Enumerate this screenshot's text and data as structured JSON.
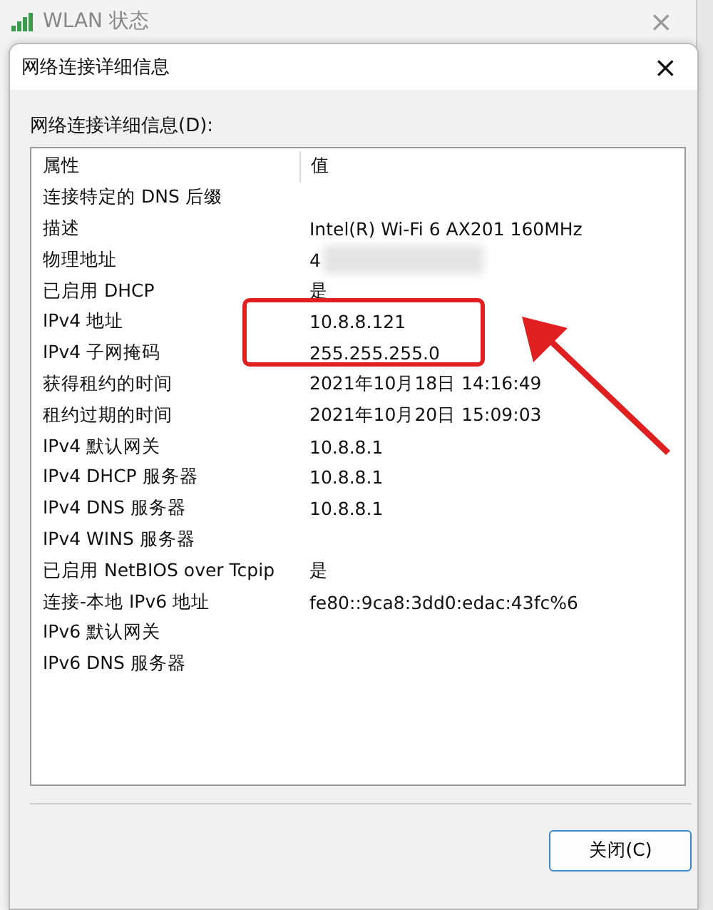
{
  "background_window": {
    "title": "WLAN 状态",
    "close": "×"
  },
  "dialog": {
    "title": "网络连接详细信息",
    "close": "×",
    "list_label": "网络连接详细信息(D):"
  },
  "table": {
    "columns": [
      "属性",
      "值"
    ],
    "rows": [
      {
        "property": "连接特定的 DNS 后缀",
        "value": ""
      },
      {
        "property": "描述",
        "value": "Intel(R) Wi-Fi 6 AX201 160MHz"
      },
      {
        "property": "物理地址",
        "value": "4",
        "redacted": true
      },
      {
        "property": "已启用 DHCP",
        "value": "是"
      },
      {
        "property": "IPv4 地址",
        "value": "10.8.8.121"
      },
      {
        "property": "IPv4 子网掩码",
        "value": "255.255.255.0"
      },
      {
        "property": "获得租约的时间",
        "value": "2021年10月18日 14:16:49"
      },
      {
        "property": "租约过期的时间",
        "value": "2021年10月20日 15:09:03"
      },
      {
        "property": "IPv4 默认网关",
        "value": "10.8.8.1"
      },
      {
        "property": "IPv4 DHCP 服务器",
        "value": "10.8.8.1"
      },
      {
        "property": "IPv4 DNS 服务器",
        "value": "10.8.8.1"
      },
      {
        "property": "IPv4 WINS 服务器",
        "value": ""
      },
      {
        "property": "已启用 NetBIOS over Tcpip",
        "value": "是"
      },
      {
        "property": "连接-本地 IPv6 地址",
        "value": "fe80::9ca8:3dd0:edac:43fc%6"
      },
      {
        "property": "IPv6 默认网关",
        "value": ""
      },
      {
        "property": "IPv6 DNS 服务器",
        "value": ""
      }
    ]
  },
  "buttons": [
    "关闭(C)"
  ]
}
